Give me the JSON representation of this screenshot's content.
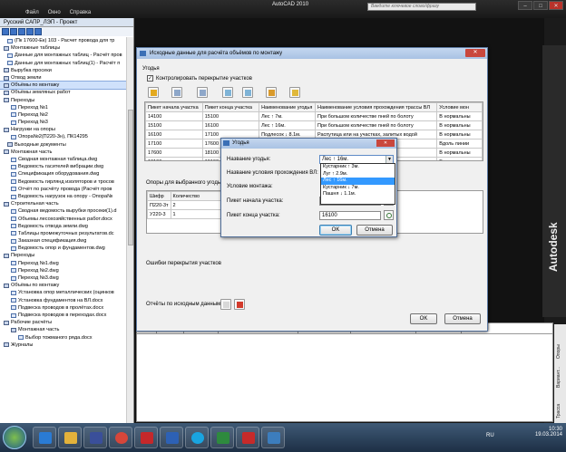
{
  "app": {
    "menus": [
      "Файл",
      "Окно",
      "Справка"
    ],
    "title": "AutoCAD 2010",
    "search_placeholder": "Введите ключевое слово/фразу",
    "brand": "Autodesk",
    "colors": {
      "accent": "#3399ff",
      "titlebar": "#a9c2e4",
      "close": "#c9473d"
    }
  },
  "project": {
    "title": "Русский САПР_ЛЭП - Проект",
    "tree": [
      {
        "label": "(Пк 17600-Ек) 103 - Расчет провода для тр",
        "icon": "doc"
      },
      {
        "label": "Монтажные таблицы",
        "icon": "grp"
      },
      {
        "label": "Данные для монтажных таблиц - Расчёт пров",
        "icon": "doc"
      },
      {
        "label": "Данные для монтажных таблиц(1) - Расчёт п",
        "icon": "doc"
      },
      {
        "label": "Вырубка просеки",
        "icon": "grp"
      },
      {
        "label": "Отвод земли",
        "icon": "grp"
      },
      {
        "label": "Объёмы по монтажу",
        "icon": "grp",
        "selected": true
      },
      {
        "label": "Объёмы земляных работ",
        "icon": "grp"
      },
      {
        "label": "Переходы",
        "icon": "grp"
      },
      {
        "label": "Переход №1",
        "icon": "doc"
      },
      {
        "label": "Переход №2",
        "icon": "doc"
      },
      {
        "label": "Переход №3",
        "icon": "doc"
      },
      {
        "label": "Нагрузки на опоры",
        "icon": "grp"
      },
      {
        "label": "Опора№2(П220-3н), ПК14295",
        "icon": "doc"
      },
      {
        "label": "Выходные документы",
        "icon": "grp"
      },
      {
        "label": "Монтажная часть",
        "icon": "grp"
      },
      {
        "label": "Сводная монтажная таблица.dwg",
        "icon": "doc"
      },
      {
        "label": "Ведомость гасителей вибрации.dwg",
        "icon": "doc"
      },
      {
        "label": "Спецификация оборудования.dwg",
        "icon": "doc"
      },
      {
        "label": "Ведомость гирлянд изоляторов и тросов",
        "icon": "doc"
      },
      {
        "label": "Отчёт по расчёту провода (Расчёт пров",
        "icon": "doc"
      },
      {
        "label": "Ведомость нагрузок на опору - Опора№",
        "icon": "doc"
      },
      {
        "label": "Строительная часть",
        "icon": "grp"
      },
      {
        "label": "Сводная ведомость вырубки просеки(1).d",
        "icon": "doc"
      },
      {
        "label": "Объемы лесохозяйственных работ.docx",
        "icon": "doc"
      },
      {
        "label": "Ведомость отвода земли.dwg",
        "icon": "doc"
      },
      {
        "label": "Таблицы промежуточных результатов.dc",
        "icon": "doc"
      },
      {
        "label": "Заказная спецификация.dwg",
        "icon": "doc"
      },
      {
        "label": "Ведомость опор и фундаментов.dwg",
        "icon": "doc"
      },
      {
        "label": "Переходы",
        "icon": "grp"
      },
      {
        "label": "Переход №1.dwg",
        "icon": "doc"
      },
      {
        "label": "Переход №2.dwg",
        "icon": "doc"
      },
      {
        "label": "Переход №3.dwg",
        "icon": "doc"
      },
      {
        "label": "Объёмы по монтажу",
        "icon": "grp"
      },
      {
        "label": "Установка опор металлических (оцинков",
        "icon": "doc"
      },
      {
        "label": "Установка фундаментов на ВЛ.docx",
        "icon": "doc"
      },
      {
        "label": "Подвеска проводов в пролётах.docx",
        "icon": "doc"
      },
      {
        "label": "Подвеска проводов в переходах.docx",
        "icon": "doc"
      },
      {
        "label": "Рабочие расчёты",
        "icon": "grp"
      },
      {
        "label": "Монтажная часть",
        "icon": "grp"
      },
      {
        "label": "Выбор тожманого ряда.docx",
        "icon": "doc"
      },
      {
        "label": "Журналы",
        "icon": "grp"
      }
    ]
  },
  "main_dialog": {
    "title": "Исходные данные для расчёта объёмов по монтажу",
    "close": "✕",
    "section_ugodya": "Угодья",
    "check_label": "Контролировать перекрытие участков",
    "check_mark": "✓",
    "table": {
      "headers": [
        "Пикет начала участка",
        "Пикет конца участка",
        "Наименование угодья",
        "Наименование условия прохождения трассы ВЛ",
        "Условие мон"
      ],
      "rows": [
        [
          "14100",
          "15100",
          "Лес ↑ 7м.",
          "При большом количестве пней по болоту",
          "В нормальны"
        ],
        [
          "15100",
          "16100",
          "Лес ↑ 16м.",
          "При большом количестве пней по болоту",
          "В нормальны"
        ],
        [
          "16100",
          "17100",
          "Подлесок ↓ 8.1м.",
          "Распутица или на участках, залитых водой",
          "В нормальны"
        ],
        [
          "17100",
          "17600",
          "",
          "",
          "Вдоль линии"
        ],
        [
          "17600",
          "18100",
          "",
          "",
          "В нормальны"
        ],
        [
          "18100",
          "19100",
          "",
          "",
          "В нормальны"
        ]
      ]
    },
    "supports_label": "Опоры для выбранного угодья",
    "supports_headers": [
      "Шифр",
      "Количество"
    ],
    "supports_rows": [
      [
        "П220-3т",
        "2"
      ],
      [
        "У220-3",
        "1"
      ]
    ],
    "errors_label": "Ошибки перекрытия участков",
    "reports_label": "Отчёты по исходным данным:",
    "ok": "OK",
    "cancel": "Отмена"
  },
  "modal": {
    "title": "Угодья",
    "close": "✕",
    "name_label": "Название угодья:",
    "name_value": "Лес ↑ 16м.",
    "condition_label": "Название условия прохождения ВЛ:",
    "montage_label": "Условие монтажа:",
    "start_label": "Пикет начала участка:",
    "start_value": "15100",
    "end_label": "Пикет конца участка:",
    "end_value": "16100",
    "ok": "OK",
    "cancel": "Отмена",
    "dropdown_options": [
      "Кустарник ↑ 3м.",
      "Луг ↑ 2.9м.",
      "Лес ↑ 16м.",
      "Кустарник ↓ 7м.",
      "Пашня ↓ 1.1м."
    ],
    "dropdown_selected_index": 2
  },
  "bottom_table": {
    "headers": [
      "Номер",
      "Пикет, м",
      "Шифр опоры",
      "Высота до нижней траверсы, м",
      "Длина пирамиды, м",
      "Банкетка/Срезка земли, м",
      "Примечание"
    ]
  },
  "side_tabs": [
    "Опоры",
    "Вариант...",
    "Трасса"
  ],
  "tray": {
    "lang": "RU",
    "time": "10:30",
    "date": "19.03.2014"
  }
}
